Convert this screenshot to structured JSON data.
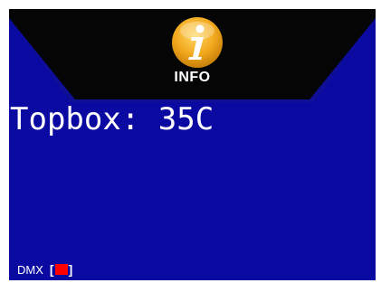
{
  "header": {
    "icon": "info-icon",
    "title": "INFO"
  },
  "main": {
    "readout": "Topbox: 35C"
  },
  "status": {
    "dmx_label": "DMX",
    "dmx_bracket_left": "[",
    "dmx_bracket_right": "]",
    "dmx_indicator_color": "#ff0000"
  },
  "colors": {
    "background": "#0a0aa2",
    "header_background": "#050505",
    "icon_fill": "#f2a81d",
    "text": "#ffffff"
  }
}
